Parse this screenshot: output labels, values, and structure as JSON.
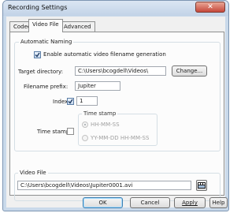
{
  "window": {
    "title": "Recording Settings",
    "close_glyph": "✕"
  },
  "tabs": [
    {
      "label": "Codec"
    },
    {
      "label": "Video File",
      "selected": true
    },
    {
      "label": "Advanced"
    }
  ],
  "auto_naming": {
    "group_title": "Automatic Naming",
    "enable_label": "Enable automatic video filename generation",
    "enable_checked": true,
    "target_dir_label": "Target directory:",
    "target_dir_value": "C:\\Users\\bcogdell\\Videos\\",
    "change_button": "Change...",
    "prefix_label": "Filename prefix:",
    "prefix_value": "Jupiter",
    "index_label": "Index",
    "index_checked": true,
    "index_value": "1",
    "timestamp_label": "Time stamp",
    "timestamp_checked": false,
    "timestamp_group_title": "Time stamp",
    "timestamp_options": [
      "HH-MM-SS",
      "YY-MM-DD HH-MM-SS"
    ],
    "timestamp_selected": 0
  },
  "video_file": {
    "group_title": "Video File",
    "path": "C:\\Users\\bcogdell\\Videos\\Jupiter0001.avi",
    "browse_icon": "folder-browse-icon"
  },
  "buttons": {
    "ok": "OK",
    "cancel": "Cancel",
    "apply": "Apply",
    "help": "Help"
  }
}
